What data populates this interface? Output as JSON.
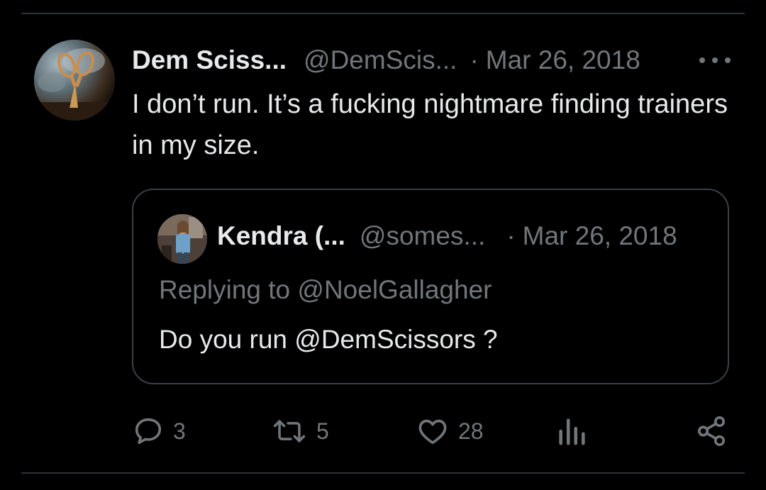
{
  "tweet": {
    "author_name": "Dem Sciss...",
    "author_handle": "@DemScis...",
    "separator": "·",
    "date": "Mar 26, 2018",
    "text": "I don’t run. It’s a fucking nightmare finding trainers in my size.",
    "avatar_icon": "scissors-avatar",
    "more_icon": "more-options-icon"
  },
  "quote": {
    "author_name": "Kendra (...",
    "author_handle": "@somes...",
    "separator": "·",
    "date": "Mar 26, 2018",
    "replying_to": "Replying to @NoelGallagher",
    "text": "Do you run @DemScissors ?",
    "avatar_icon": "person-avatar"
  },
  "actions": {
    "reply_count": "3",
    "retweet_count": "5",
    "like_count": "28",
    "icons": [
      "reply-icon",
      "retweet-icon",
      "like-icon",
      "views-icon",
      "share-icon"
    ]
  },
  "colors": {
    "background": "#000000",
    "text_primary": "#e7e9ea",
    "text_secondary": "#71767b",
    "border": "#3b4045"
  }
}
